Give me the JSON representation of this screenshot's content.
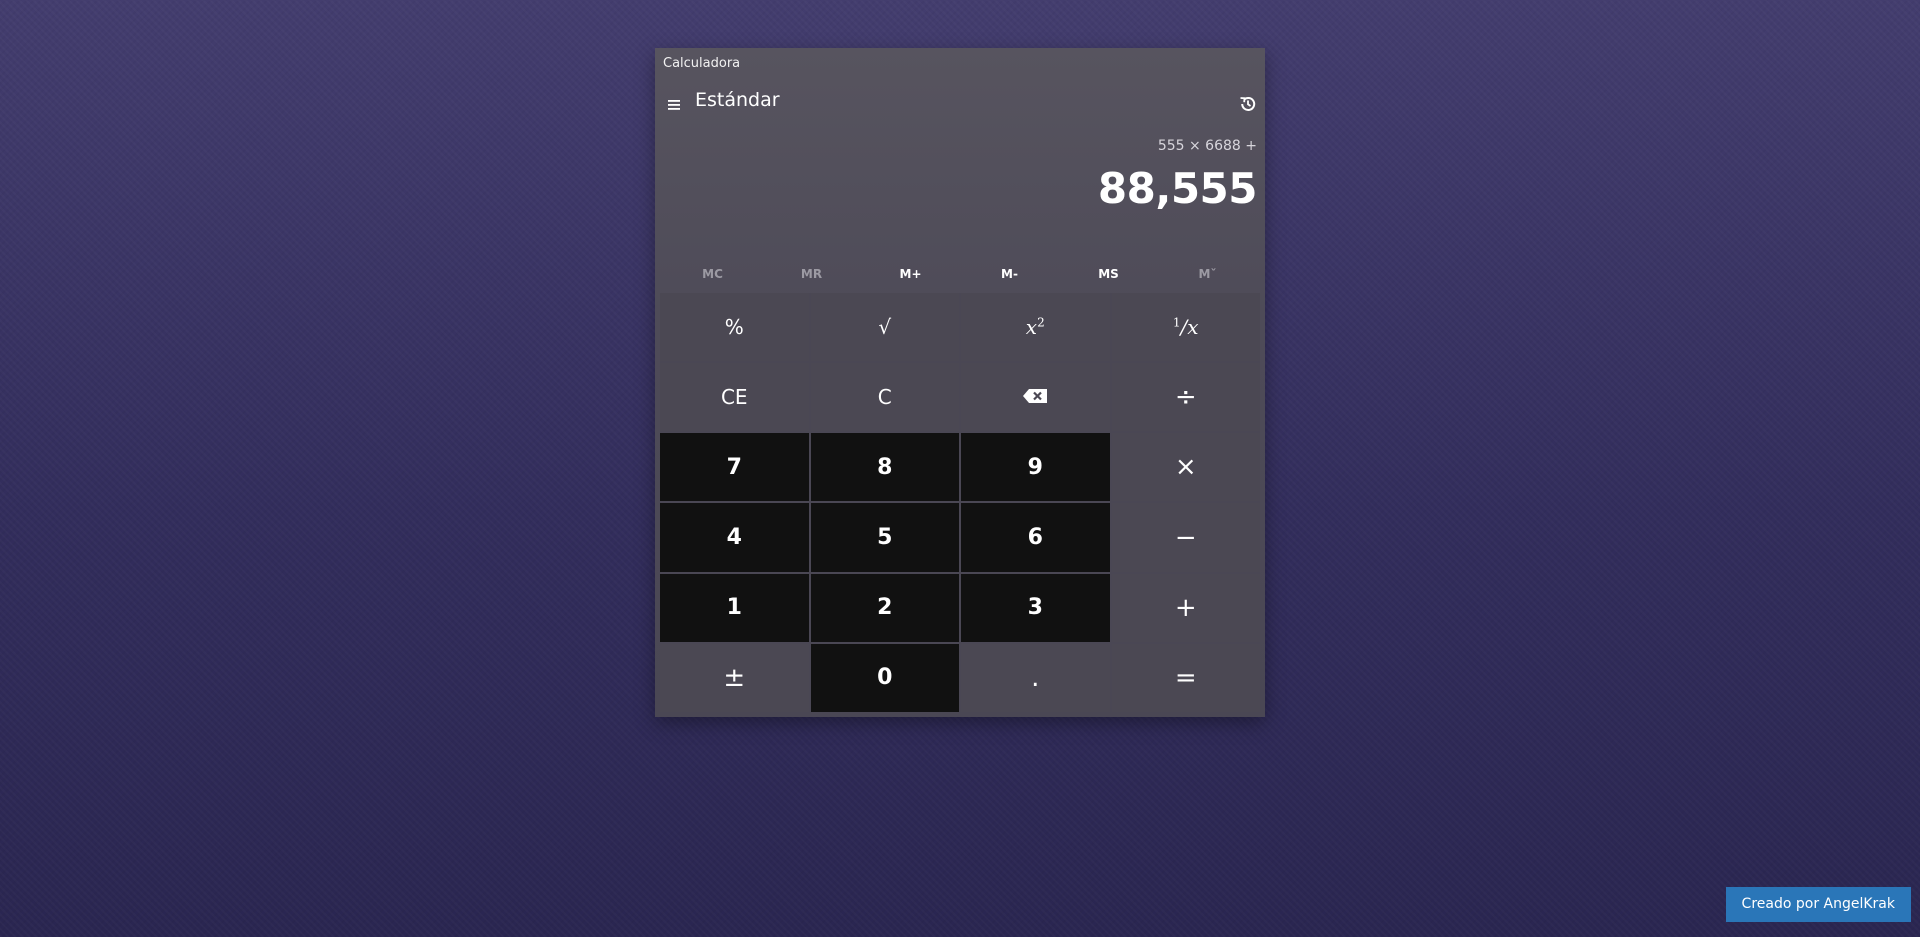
{
  "app": {
    "window_title": "Calculadora",
    "mode_title": "Estándar"
  },
  "display": {
    "expression": "555 × 6688 +",
    "result": "88,555"
  },
  "memory": [
    {
      "label": "MC",
      "enabled": false
    },
    {
      "label": "MR",
      "enabled": false
    },
    {
      "label": "M+",
      "enabled": true
    },
    {
      "label": "M-",
      "enabled": true
    },
    {
      "label": "MS",
      "enabled": true
    },
    {
      "label": "Mˇ",
      "enabled": false
    }
  ],
  "keys": {
    "percent": "%",
    "sqrt": "√",
    "square_base": "x",
    "square_exp": "2",
    "reciprocal_num": "1",
    "reciprocal_den": "/x",
    "ce": "CE",
    "c": "C",
    "divide": "÷",
    "seven": "7",
    "eight": "8",
    "nine": "9",
    "multiply": "×",
    "four": "4",
    "five": "5",
    "six": "6",
    "minus": "−",
    "one": "1",
    "two": "2",
    "three": "3",
    "plus": "+",
    "negate": "±",
    "zero": "0",
    "decimal": ".",
    "equals": "="
  },
  "icons": {
    "menu": "hamburger-menu-icon",
    "history": "history-icon",
    "backspace": "backspace-icon"
  },
  "footer": {
    "credit": "Creado por AngelKrak"
  }
}
